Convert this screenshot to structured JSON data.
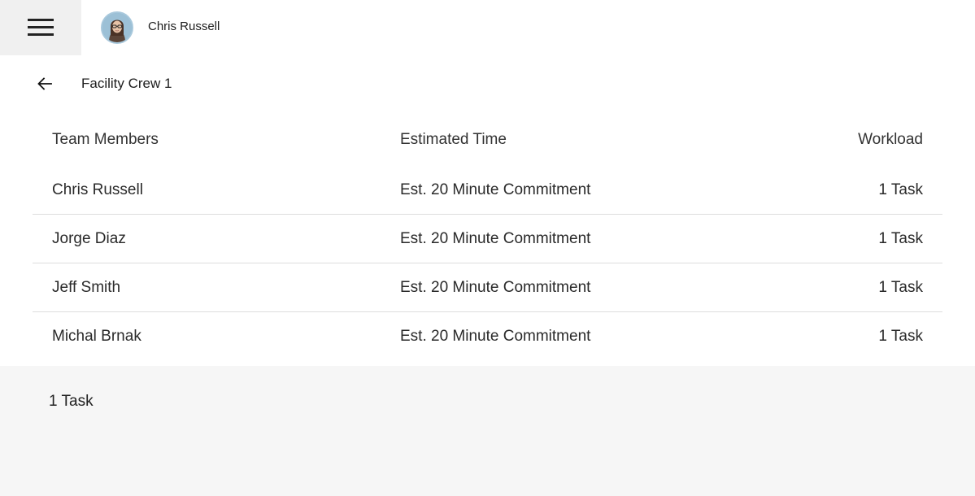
{
  "header": {
    "menu_icon": "hamburger-menu-icon",
    "user": {
      "name": "Chris Russell",
      "avatar_icon": "user-avatar"
    }
  },
  "page": {
    "back_icon": "arrow-left-icon",
    "title": "Facility Crew 1"
  },
  "table": {
    "columns": [
      "Team Members",
      "Estimated Time",
      "Workload"
    ],
    "rows": [
      {
        "member": "Chris Russell",
        "time": "Est. 20 Minute Commitment",
        "workload": "1 Task"
      },
      {
        "member": "Jorge Diaz",
        "time": "Est. 20 Minute Commitment",
        "workload": "1 Task"
      },
      {
        "member": "Jeff Smith",
        "time": "Est. 20 Minute Commitment",
        "workload": "1 Task"
      },
      {
        "member": "Michal Brnak",
        "time": "Est. 20 Minute Commitment",
        "workload": "1 Task"
      }
    ]
  },
  "footer": {
    "summary": "1 Task"
  },
  "colors": {
    "menu_bg": "#f0f0f0",
    "footer_bg": "#f6f6f6",
    "divider": "#dddddd",
    "text": "#222222"
  }
}
